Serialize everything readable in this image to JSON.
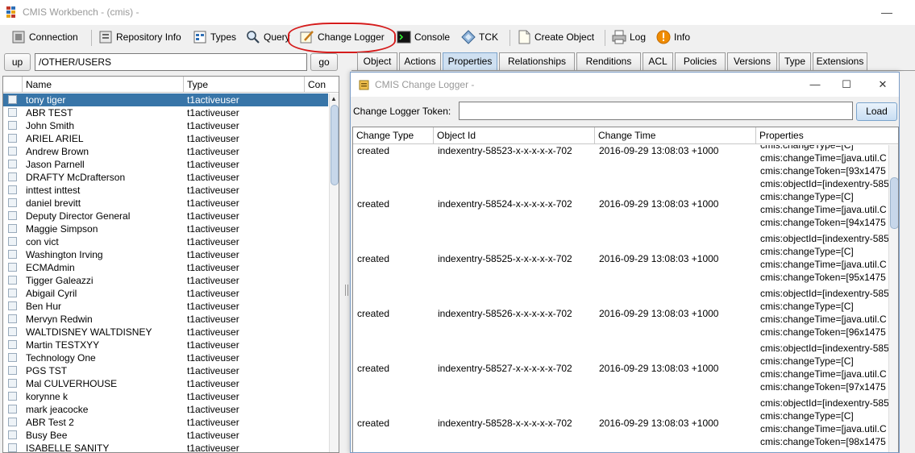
{
  "window": {
    "title": "CMIS Workbench - (cmis) -",
    "minimize": "—"
  },
  "toolbar": {
    "items": [
      {
        "label": "Connection"
      },
      {
        "label": "Repository Info"
      },
      {
        "label": "Types"
      },
      {
        "label": "Query"
      },
      {
        "label": "Change Logger"
      },
      {
        "label": "Console"
      },
      {
        "label": "TCK"
      },
      {
        "label": "Create Object"
      },
      {
        "label": "Log"
      },
      {
        "label": "Info"
      }
    ],
    "highlight_color": "#d51c1c"
  },
  "folder": {
    "up_label": "up",
    "path": "/OTHER/USERS",
    "go_label": "go",
    "columns": [
      "Name",
      "Type",
      "Con"
    ],
    "rows": [
      {
        "name": "tony tiger",
        "type": "t1activeuser"
      },
      {
        "name": "ABR TEST",
        "type": "t1activeuser"
      },
      {
        "name": "John Smith",
        "type": "t1activeuser"
      },
      {
        "name": "ARIEL ARIEL",
        "type": "t1activeuser"
      },
      {
        "name": "Andrew Brown",
        "type": "t1activeuser"
      },
      {
        "name": "Jason Parnell",
        "type": "t1activeuser"
      },
      {
        "name": "DRAFTY McDrafterson",
        "type": "t1activeuser"
      },
      {
        "name": "inttest inttest",
        "type": "t1activeuser"
      },
      {
        "name": "daniel brevitt",
        "type": "t1activeuser"
      },
      {
        "name": "Deputy Director General",
        "type": "t1activeuser"
      },
      {
        "name": "Maggie Simpson",
        "type": "t1activeuser"
      },
      {
        "name": "con vict",
        "type": "t1activeuser"
      },
      {
        "name": "Washington Irving",
        "type": "t1activeuser"
      },
      {
        "name": "ECMAdmin",
        "type": "t1activeuser"
      },
      {
        "name": "Tigger Galeazzi",
        "type": "t1activeuser"
      },
      {
        "name": "Abigail Cyril",
        "type": "t1activeuser"
      },
      {
        "name": "Ben Hur",
        "type": "t1activeuser"
      },
      {
        "name": "Mervyn Redwin",
        "type": "t1activeuser"
      },
      {
        "name": "WALTDISNEY WALTDISNEY",
        "type": "t1activeuser"
      },
      {
        "name": "Martin TESTXYY",
        "type": "t1activeuser"
      },
      {
        "name": "Technology One",
        "type": "t1activeuser"
      },
      {
        "name": "PGS TST",
        "type": "t1activeuser"
      },
      {
        "name": "Mal CULVERHOUSE",
        "type": "t1activeuser"
      },
      {
        "name": "korynne k",
        "type": "t1activeuser"
      },
      {
        "name": "mark jeacocke",
        "type": "t1activeuser"
      },
      {
        "name": "ABR Test 2",
        "type": "t1activeuser"
      },
      {
        "name": "Busy Bee",
        "type": "t1activeuser"
      },
      {
        "name": "ISABELLE SANITY",
        "type": "t1activeuser"
      }
    ],
    "selection_color": "#3875a8"
  },
  "tabs": [
    "Object",
    "Actions",
    "Properties",
    "Relationships",
    "Renditions",
    "ACL",
    "Policies",
    "Versions",
    "Type",
    "Extensions"
  ],
  "active_tab": "Properties",
  "dialog": {
    "title": "CMIS Change Logger -",
    "token_label": "Change Logger Token:",
    "token_value": "",
    "load_label": "Load",
    "columns": [
      "Change Type",
      "Object Id",
      "Change Time",
      "Properties"
    ],
    "first_row_partial": {
      "change_type": "created",
      "object_id": "indexentry-58523-x-x-x-x-x-702",
      "change_time": "2016-09-29 13:08:03 +1000",
      "properties": [
        "cmis:changeType=[C]",
        "cmis:changeTime=[java.util.C",
        "cmis:changeToken=[93x1475"
      ]
    },
    "rows": [
      {
        "change_type": "created",
        "object_id": "indexentry-58524-x-x-x-x-x-702",
        "change_time": "2016-09-29 13:08:03 +1000",
        "properties": [
          "cmis:objectId=[indexentry-585",
          "cmis:changeType=[C]",
          "cmis:changeTime=[java.util.C",
          "cmis:changeToken=[94x1475"
        ]
      },
      {
        "change_type": "created",
        "object_id": "indexentry-58525-x-x-x-x-x-702",
        "change_time": "2016-09-29 13:08:03 +1000",
        "properties": [
          "cmis:objectId=[indexentry-585",
          "cmis:changeType=[C]",
          "cmis:changeTime=[java.util.C",
          "cmis:changeToken=[95x1475"
        ]
      },
      {
        "change_type": "created",
        "object_id": "indexentry-58526-x-x-x-x-x-702",
        "change_time": "2016-09-29 13:08:03 +1000",
        "properties": [
          "cmis:objectId=[indexentry-585",
          "cmis:changeType=[C]",
          "cmis:changeTime=[java.util.C",
          "cmis:changeToken=[96x1475"
        ]
      },
      {
        "change_type": "created",
        "object_id": "indexentry-58527-x-x-x-x-x-702",
        "change_time": "2016-09-29 13:08:03 +1000",
        "properties": [
          "cmis:objectId=[indexentry-585",
          "cmis:changeType=[C]",
          "cmis:changeTime=[java.util.C",
          "cmis:changeToken=[97x1475"
        ]
      },
      {
        "change_type": "created",
        "object_id": "indexentry-58528-x-x-x-x-x-702",
        "change_time": "2016-09-29 13:08:03 +1000",
        "properties": [
          "cmis:objectId=[indexentry-585",
          "cmis:changeType=[C]",
          "cmis:changeTime=[java.util.C",
          "cmis:changeToken=[98x1475"
        ]
      }
    ]
  }
}
